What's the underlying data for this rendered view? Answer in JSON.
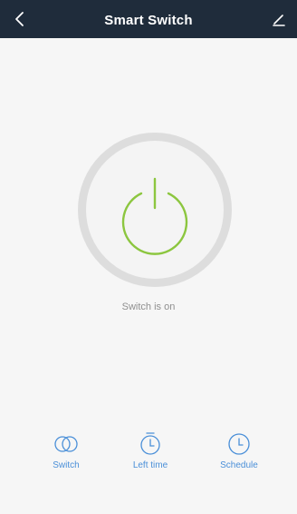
{
  "header": {
    "title": "Smart Switch",
    "back_icon": "chevron-left-icon",
    "edit_icon": "pencil-icon"
  },
  "power": {
    "icon": "power-icon",
    "state": "on",
    "accent_color": "#8cc63f"
  },
  "status": {
    "text": "Switch is on"
  },
  "bottom_bar": {
    "items": [
      {
        "label": "Switch",
        "icon": "toggle-circles-icon"
      },
      {
        "label": "Left time",
        "icon": "timer-icon"
      },
      {
        "label": "Schedule",
        "icon": "clock-icon"
      }
    ],
    "color": "#4a8fd8"
  }
}
